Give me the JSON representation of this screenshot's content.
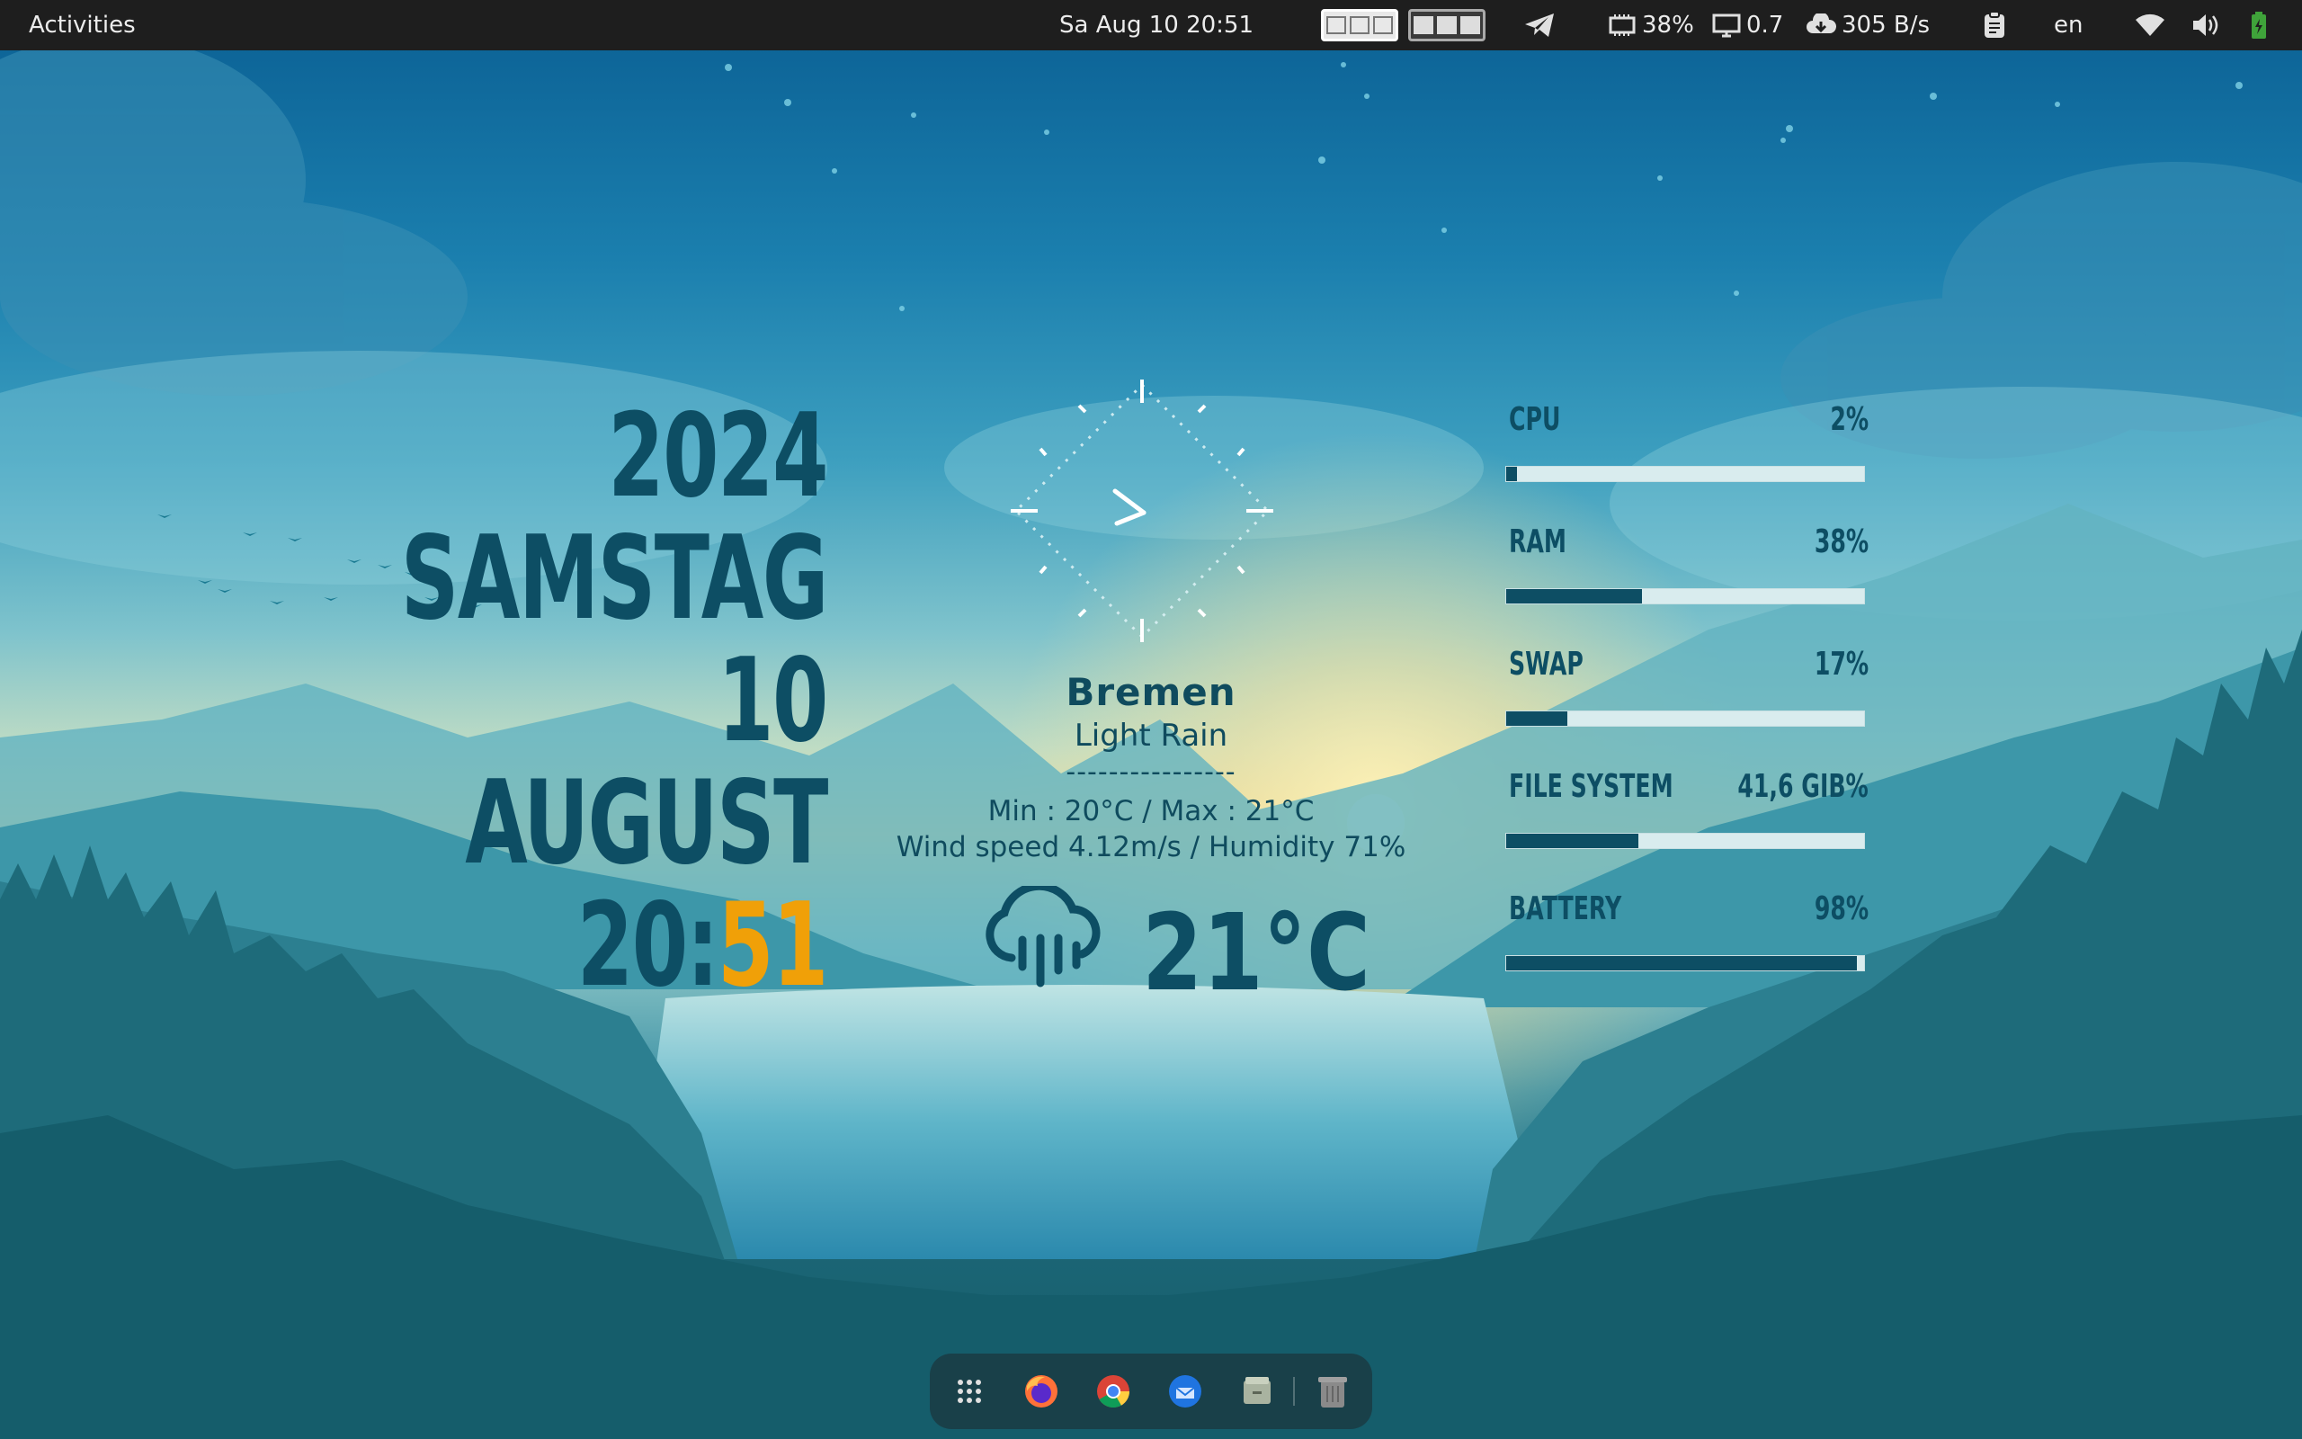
{
  "topbar": {
    "activities": "Activities",
    "clock": "Sa Aug 10  20:51",
    "memory": "38%",
    "load": "0.7",
    "network": "305 B/s",
    "keyboard_layout": "en",
    "icons": [
      "telegram-icon",
      "memory-icon",
      "monitor-icon",
      "cloud-download-icon",
      "clipboard-icon",
      "wifi-icon",
      "volume-icon",
      "battery-icon"
    ]
  },
  "date_widget": {
    "year": "2024",
    "weekday": "SAMSTAG",
    "day": "10",
    "month": "AUGUST",
    "hour": "20:",
    "minute": "51"
  },
  "weather": {
    "city": "Bremen",
    "condition": "Light Rain",
    "separator": "----------------",
    "minmax": "Min : 20°C / Max : 21°C",
    "wind_humidity": "Wind speed 4.12m/s / Humidity 71%",
    "temperature": "21°C",
    "icon": "rain-cloud-icon"
  },
  "stats": [
    {
      "label": "CPU",
      "value": "2%",
      "fraction": 0.02
    },
    {
      "label": "RAM",
      "value": "38%",
      "fraction": 0.38
    },
    {
      "label": "SWAP",
      "value": "17%",
      "fraction": 0.17
    },
    {
      "label": "FILE SYSTEM",
      "value": "41,6 GIB%",
      "fraction": 0.37
    },
    {
      "label": "BATTERY",
      "value": "98%",
      "fraction": 0.98
    }
  ],
  "dock": {
    "items": [
      "app-grid-icon",
      "firefox-icon",
      "chrome-icon",
      "thunderbird-icon",
      "files-icon",
      "trash-icon"
    ]
  },
  "colors": {
    "accent": "#0d4e64",
    "minute": "#f0a008",
    "topbar": "#1e1e1e"
  }
}
